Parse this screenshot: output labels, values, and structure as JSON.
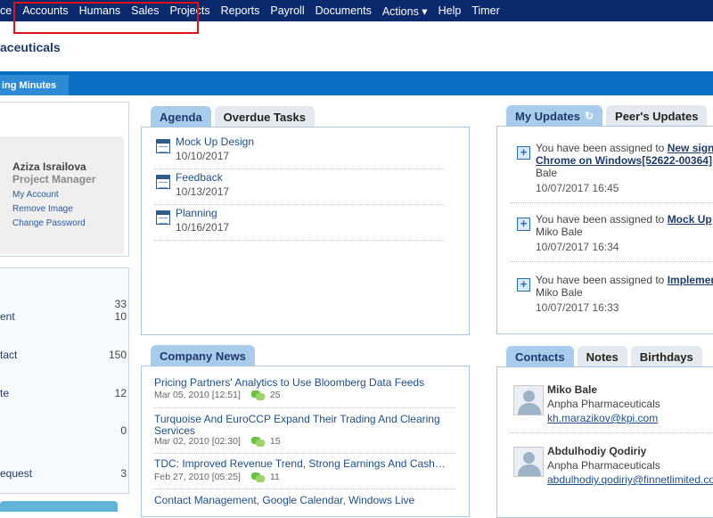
{
  "topnav": {
    "items": [
      "ce",
      "Accounts",
      "Humans",
      "Sales",
      "Projects",
      "Reports",
      "Payroll",
      "Documents",
      "Actions ▾",
      "Help",
      "Timer"
    ]
  },
  "company": {
    "title": "aceuticals"
  },
  "subtab": {
    "label": "ing Minutes"
  },
  "profile": {
    "name": "Aziza Israilova",
    "role": "Project Manager",
    "links": [
      "My Account",
      "Remove Image",
      "Change Password"
    ]
  },
  "stats": [
    {
      "label": "",
      "value": "33"
    },
    {
      "label": "ent",
      "value": "10"
    },
    {
      "label": "tact",
      "value": "150"
    },
    {
      "label": "te",
      "value": "12"
    },
    {
      "label": "",
      "value": "0"
    },
    {
      "label": "equest",
      "value": "3"
    }
  ],
  "agenda": {
    "tabs": [
      "Agenda",
      "Overdue Tasks"
    ],
    "items": [
      {
        "title": "Mock Up Design",
        "date": "10/10/2017"
      },
      {
        "title": "Feedback",
        "date": "10/13/2017"
      },
      {
        "title": "Planning",
        "date": "10/16/2017"
      }
    ]
  },
  "updates": {
    "tabs": [
      "My Updates",
      "Peer's Updates"
    ],
    "items": [
      {
        "prefix": "You have been assigned to ",
        "link": "New sign",
        "line2_link": "Chrome on Windows[52622-00364]",
        "line3": "Bale",
        "date": "10/07/2017 16:45"
      },
      {
        "prefix": "You have been assigned to ",
        "link": "Mock Up",
        "line2": "Miko Bale",
        "date": "10/07/2017 16:34"
      },
      {
        "prefix": "You have been assigned to ",
        "link": "Implemen",
        "line2": "Miko Bale",
        "date": "10/07/2017 16:33"
      }
    ]
  },
  "news": {
    "tab": "Company News",
    "items": [
      {
        "title": "Pricing Partners' Analytics to Use Bloomberg Data Feeds",
        "date": "Mar 05, 2010 [12:51]",
        "comments": "25"
      },
      {
        "title": "Turquoise And EuroCCP Expand Their Trading And Clearing Services",
        "date": "Mar 02, 2010 [02:30]",
        "comments": "15"
      },
      {
        "title": "TDC: Improved Revenue Trend, Strong Earnings And Cash…",
        "date": "Feb 27, 2010 [05:25]",
        "comments": "11"
      },
      {
        "title": "Contact Management, Google Calendar, Windows Live",
        "date": "",
        "comments": ""
      }
    ]
  },
  "contacts": {
    "tabs": [
      "Contacts",
      "Notes",
      "Birthdays"
    ],
    "items": [
      {
        "name": "Miko Bale",
        "company": "Anpha Pharmaceuticals",
        "email": "kh.marazikov@kpi.com"
      },
      {
        "name": "Abdulhodiy Qodiriy",
        "company": "Anpha Pharmaceuticals",
        "email": "abdulhodiy.qodiriy@finnetlimited.com"
      }
    ]
  }
}
